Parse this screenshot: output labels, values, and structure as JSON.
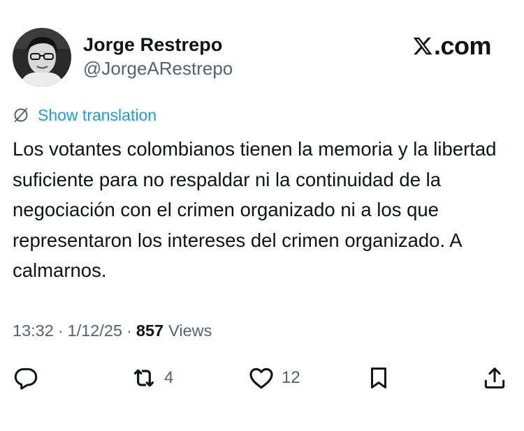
{
  "author": {
    "display_name": "Jorge Restrepo",
    "handle": "@JorgeARestrepo"
  },
  "brand": {
    "label": ".com",
    "icon": "x-logo-icon"
  },
  "translation": {
    "label": "Show translation",
    "icon": "translate-icon"
  },
  "tweet": {
    "text": "Los votantes colombianos tienen la memoria y la libertad suficiente para no respaldar ni la continuidad de la negociación con el crimen organizado ni a los que representaron los intereses del crimen organizado. A calmarnos."
  },
  "meta": {
    "time": "13:32",
    "separator": "·",
    "date": "1/12/25",
    "views_count": "857",
    "views_label": "Views"
  },
  "actions": {
    "reply": {
      "icon": "reply-icon"
    },
    "retweet": {
      "icon": "retweet-icon",
      "count": "4"
    },
    "like": {
      "icon": "heart-icon",
      "count": "12"
    },
    "bookmark": {
      "icon": "bookmark-icon"
    },
    "share": {
      "icon": "share-icon"
    }
  },
  "colors": {
    "text": "#0f1419",
    "secondary": "#536471",
    "link": "#1d9bf0",
    "background": "#ffffff"
  }
}
